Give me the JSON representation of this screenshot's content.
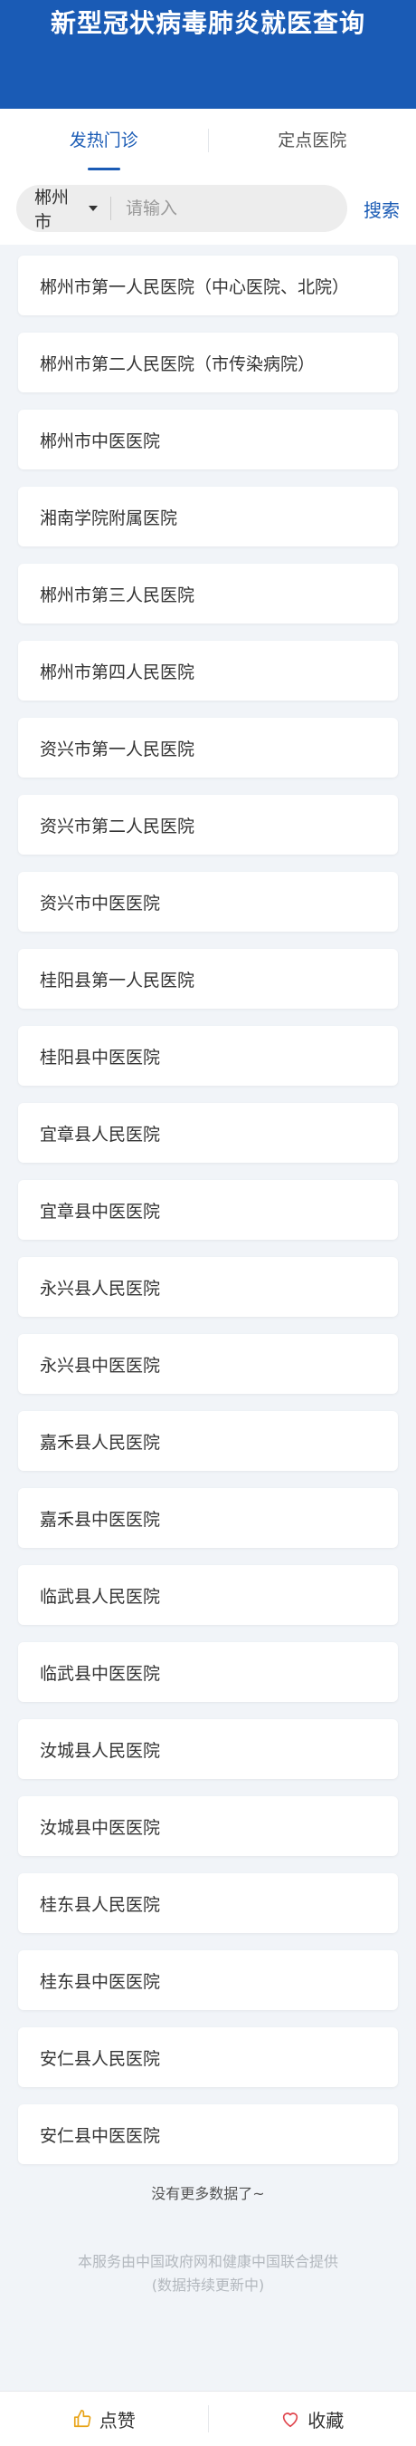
{
  "header": {
    "title": "新型冠状病毒肺炎就医查询"
  },
  "tabs": [
    {
      "label": "发热门诊"
    },
    {
      "label": "定点医院"
    }
  ],
  "search": {
    "city": "郴州市",
    "placeholder": "请输入",
    "button": "搜索"
  },
  "hospitals": [
    "郴州市第一人民医院（中心医院、北院）",
    "郴州市第二人民医院（市传染病院）",
    "郴州市中医医院",
    "湘南学院附属医院",
    "郴州市第三人民医院",
    "郴州市第四人民医院",
    "资兴市第一人民医院",
    "资兴市第二人民医院",
    "资兴市中医医院",
    "桂阳县第一人民医院",
    "桂阳县中医医院",
    "宜章县人民医院",
    "宜章县中医医院",
    "永兴县人民医院",
    "永兴县中医医院",
    "嘉禾县人民医院",
    "嘉禾县中医医院",
    "临武县人民医院",
    "临武县中医医院",
    "汝城县人民医院",
    "汝城县中医医院",
    "桂东县人民医院",
    "桂东县中医医院",
    "安仁县人民医院",
    "安仁县中医医院"
  ],
  "footer": {
    "no_more": "没有更多数据了~",
    "credit_line1": "本服务由中国政府网和健康中国联合提供",
    "credit_line2": "(数据持续更新中)"
  },
  "bottom_bar": {
    "like": "点赞",
    "favorite": "收藏"
  },
  "colors": {
    "brand": "#1a5bb5",
    "favorite_icon": "#e0464e"
  }
}
